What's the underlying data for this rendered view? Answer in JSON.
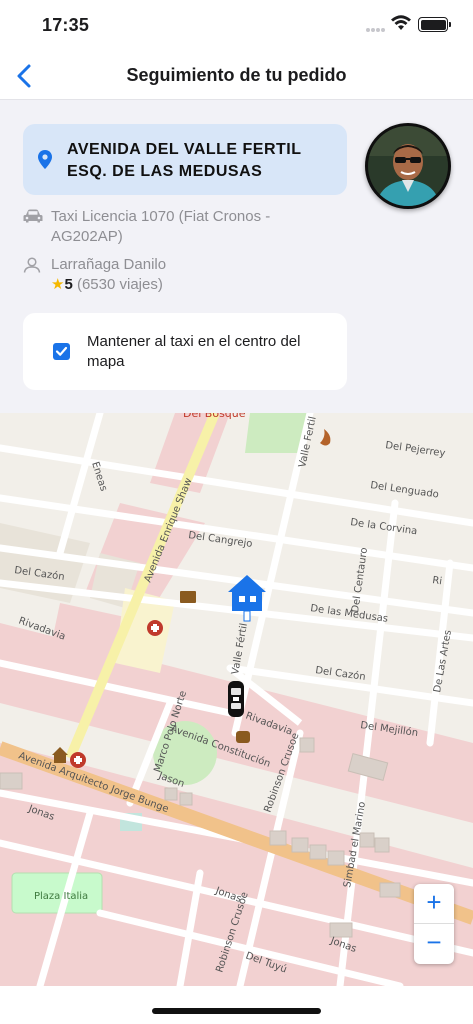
{
  "status_bar": {
    "time": "17:35"
  },
  "nav": {
    "title": "Seguimiento de tu pedido",
    "back_icon": "chevron-left-icon"
  },
  "destination": {
    "address": "AVENIDA DEL VALLE FERTIL ESQ. DE LAS MEDUSAS",
    "icon": "location-pin-icon"
  },
  "vehicle": {
    "text": "Taxi Licencia 1070 (Fiat Cronos - AG202AP)",
    "icon": "car-icon"
  },
  "driver": {
    "name": "Larrañaga Danilo",
    "rating": "5",
    "trips": "(6530 viajes)",
    "icon": "person-icon"
  },
  "center_toggle": {
    "label": "Mantener al taxi en el centro del mapa",
    "checked": true
  },
  "map": {
    "streets": [
      "Del Bosque",
      "Eneas",
      "Del Pejerrey",
      "Valle Fertil",
      "Del Lenguado",
      "Avenida Enrique Shaw",
      "Del Cangrejo",
      "De la Corvina",
      "Del Cazón",
      "Del Centauro",
      "De las Medusas",
      "Rivadavia",
      "Valle Fértil",
      "Del Cazón",
      "De Las Artes",
      "Marco Polo Norte",
      "Rivadavia",
      "Del Mejillón",
      "Avenida Constitución",
      "Jason",
      "Robinson Crusoe",
      "Avenida Arquitecto Jorge Bunge",
      "Jonas",
      "Simbad el Marino",
      "Plaza Italia",
      "Jonas",
      "Robinson Crusoe",
      "Del Tuyú"
    ],
    "accent_color": "#1a73e8"
  },
  "zoom": {
    "in_label": "+",
    "out_label": "−"
  }
}
